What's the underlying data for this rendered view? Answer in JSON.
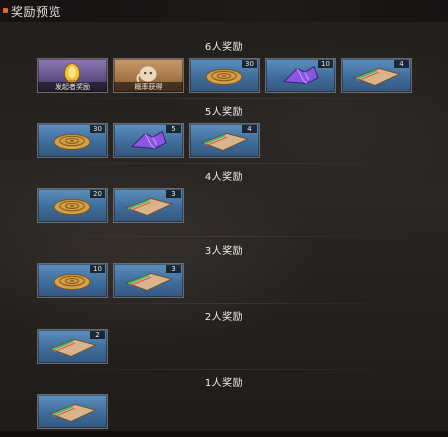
{
  "title": "奖励预览",
  "colors": {
    "accent": "#e36b21",
    "slot_blue": "#4a7aa8",
    "slot_purple": "#6a5a92",
    "slot_gold": "#b0804f"
  },
  "tiers": [
    {
      "label": "6人奖励",
      "items": [
        {
          "icon": "gold-coin-trophy-icon",
          "bg": "purple",
          "caption": "发起者奖励"
        },
        {
          "icon": "ghost-spirit-icon",
          "bg": "gold",
          "caption": "概率获得"
        },
        {
          "icon": "gold-coin-icon",
          "bg": "blue",
          "count": "30"
        },
        {
          "icon": "purple-crystal-icon",
          "bg": "blue",
          "count": "10"
        },
        {
          "icon": "scroll-book-icon",
          "bg": "blue",
          "count": "4"
        }
      ]
    },
    {
      "label": "5人奖励",
      "items": [
        {
          "icon": "gold-coin-icon",
          "bg": "blue",
          "count": "30"
        },
        {
          "icon": "purple-crystal-icon",
          "bg": "blue",
          "count": "5"
        },
        {
          "icon": "scroll-book-icon",
          "bg": "blue",
          "count": "4"
        }
      ]
    },
    {
      "label": "4人奖励",
      "items": [
        {
          "icon": "gold-coin-icon",
          "bg": "blue",
          "count": "20"
        },
        {
          "icon": "scroll-book-icon",
          "bg": "blue",
          "count": "3"
        }
      ]
    },
    {
      "label": "3人奖励",
      "items": [
        {
          "icon": "gold-coin-icon",
          "bg": "blue",
          "count": "10"
        },
        {
          "icon": "scroll-book-icon",
          "bg": "blue",
          "count": "3"
        }
      ]
    },
    {
      "label": "2人奖励",
      "items": [
        {
          "icon": "scroll-book-icon",
          "bg": "blue",
          "count": "2"
        }
      ]
    },
    {
      "label": "1人奖励",
      "items": [
        {
          "icon": "scroll-book-icon",
          "bg": "blue"
        }
      ]
    }
  ]
}
